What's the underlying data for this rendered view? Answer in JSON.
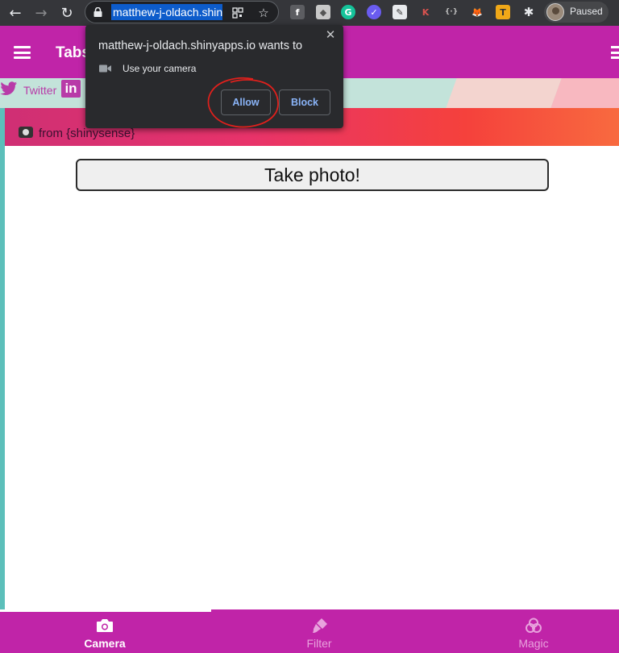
{
  "browser": {
    "url_text": "matthew-j-oldach.shinyapps.io",
    "profile_status": "Paused",
    "extensions": [
      "facebook-extension-icon",
      "cube-extension-icon",
      "grammarly-extension-icon",
      "check-extension-icon",
      "pen-extension-icon",
      "k-extension-icon",
      "bracket-extension-icon",
      "metamask-extension-icon",
      "t-extension-icon",
      "puzzle-extensions-icon"
    ]
  },
  "header": {
    "title": "Tabs"
  },
  "social": {
    "twitter_label": "Twitter",
    "linkedin_label": "in"
  },
  "source_bar": {
    "text": "from {shinysense}"
  },
  "main": {
    "take_photo_label": "Take photo!"
  },
  "bottom_nav": {
    "tabs": [
      {
        "label": "Camera",
        "icon": "camera-icon",
        "active": true
      },
      {
        "label": "Filter",
        "icon": "brush-icon",
        "active": false
      },
      {
        "label": "Magic",
        "icon": "circles-icon",
        "active": false
      }
    ]
  },
  "permission_popup": {
    "title": "matthew-j-oldach.shinyapps.io wants to",
    "permission_text": "Use your camera",
    "allow_label": "Allow",
    "block_label": "Block",
    "close_glyph": "✕"
  },
  "colors": {
    "brand": "#c024a8",
    "chrome": "#35363a",
    "popup_bg": "#292a2d",
    "button_text": "#8ab4f8",
    "annotation": "#e0201c"
  }
}
